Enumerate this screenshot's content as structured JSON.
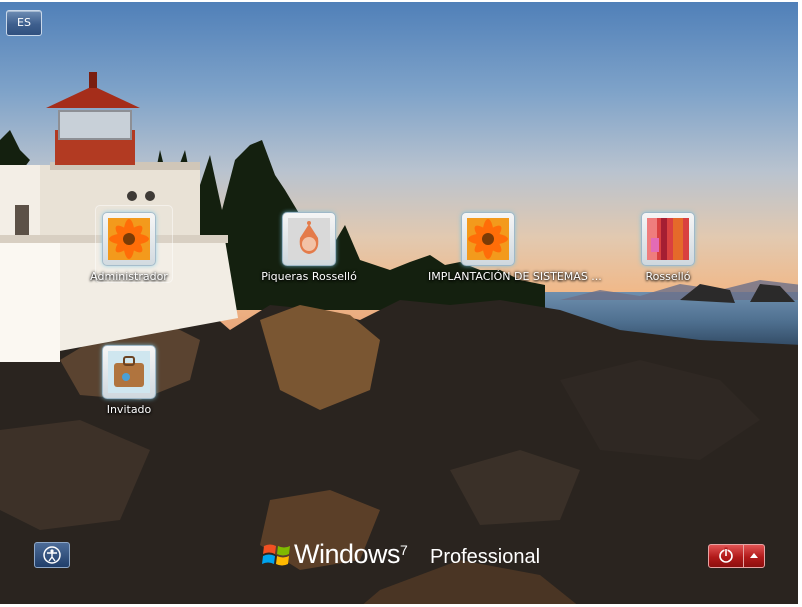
{
  "language_button": {
    "label": "ES"
  },
  "users": [
    {
      "name": "Administrador",
      "picture": "orange-flower",
      "selected": true
    },
    {
      "name": "Piqueras Rosselló",
      "picture": "robot-figure",
      "selected": false
    },
    {
      "name": "IMPLANTACIÓN DE SISTEMAS ...",
      "picture": "orange-flower",
      "selected": false
    },
    {
      "name": "Rosselló",
      "picture": "striped-fabric",
      "selected": false
    },
    {
      "name": "Invitado",
      "picture": "suitcase",
      "selected": false
    }
  ],
  "branding": {
    "product": "Windows",
    "version": "7",
    "edition": "Professional"
  },
  "bottom": {
    "ease_of_access_icon": "ease-of-access-icon",
    "power_icon": "power-icon",
    "power_options_icon": "chevron-up-icon"
  },
  "colors": {
    "power_red": "#b21a1a",
    "tile_glow": "#78c8e6",
    "accent_blue": "#30507f"
  }
}
